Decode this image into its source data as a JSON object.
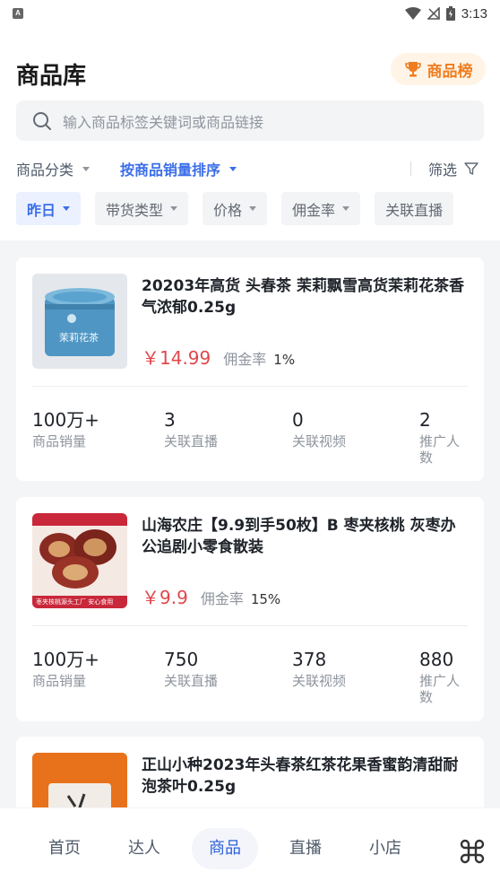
{
  "status_bar": {
    "app_badge": "A",
    "time": "3:13"
  },
  "header": {
    "title": "商品库",
    "rank_button": "商品榜",
    "search_placeholder": "输入商品标签关键词或商品链接"
  },
  "sort": {
    "category": "商品分类",
    "sort_by": "按商品销量排序",
    "filter": "筛选"
  },
  "chips": [
    "昨日",
    "带货类型",
    "价格",
    "佣金率",
    "关联直播"
  ],
  "stat_labels": {
    "sales": "商品销量",
    "live": "关联直播",
    "video": "关联视频",
    "promoters": "推广人数"
  },
  "products": [
    {
      "title": "20203年高货 头春茶 茉莉飘雪高货茉莉花茶香气浓郁0.25g",
      "price": "￥14.99",
      "commission_label": "佣金率",
      "commission": "1%",
      "sales": "100万+",
      "live": "3",
      "video": "0",
      "promoters": "2",
      "thumb_text": "茉莉花茶"
    },
    {
      "title": "山海农庄【9.9到手50枚】B 枣夹核桃 灰枣办公追剧小零食散装",
      "price": "￥9.9",
      "commission_label": "佣金率",
      "commission": "15%",
      "sales": "100万+",
      "live": "750",
      "video": "378",
      "promoters": "880",
      "thumb_text": "枣夹核桃源头工厂 安心食用"
    },
    {
      "title": "正山小种2023年头春茶红茶花果香蜜韵清甜耐泡茶叶0.25g"
    }
  ],
  "tabs": [
    "首页",
    "达人",
    "商品",
    "直播",
    "小店"
  ],
  "colors": {
    "accent": "#3b6ee8",
    "price": "#e2474c",
    "rank": "#ef7d1f"
  }
}
